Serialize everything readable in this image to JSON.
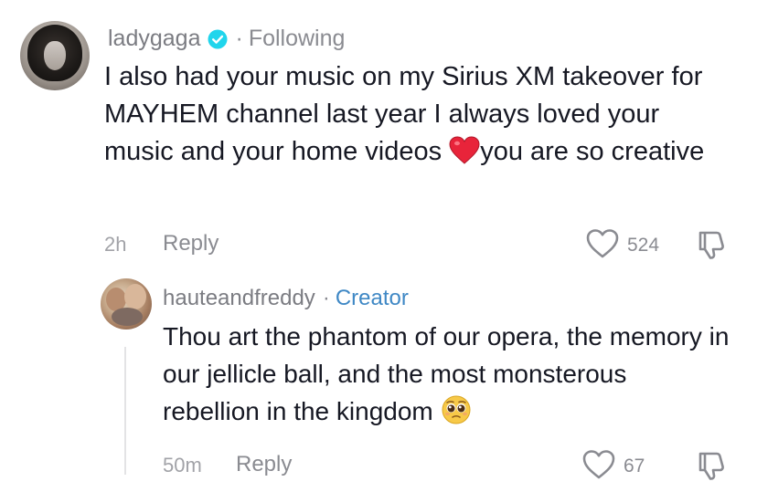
{
  "comment": {
    "username": "ladygaga",
    "separator": "·",
    "follow_status": "Following",
    "text_part1": "I also had your music on my Sirius XM takeover for MAYHEM channel last year I always loved your music and your home videos ",
    "text_part2": "you are so creative",
    "emoji": "red-heart",
    "time": "2h",
    "reply_label": "Reply",
    "like_count": "524"
  },
  "reply": {
    "username": "hauteandfreddy",
    "separator": "·",
    "badge": "Creator",
    "text": "Thou art the phantom of our opera, the memory in our jellicle ball, and the most monsterous rebellion in the kingdom ",
    "emoji": "pleading-face",
    "time": "50m",
    "reply_label": "Reply",
    "like_count": "67"
  },
  "colors": {
    "text": "#161823",
    "muted": "#8a8b91",
    "creator": "#3f88c5",
    "verified": "#20d5ec",
    "heart": "#e8243a"
  },
  "icons": [
    "verified-badge-icon",
    "heart-outline-icon",
    "dislike-icon",
    "red-heart-emoji",
    "pleading-face-emoji"
  ]
}
